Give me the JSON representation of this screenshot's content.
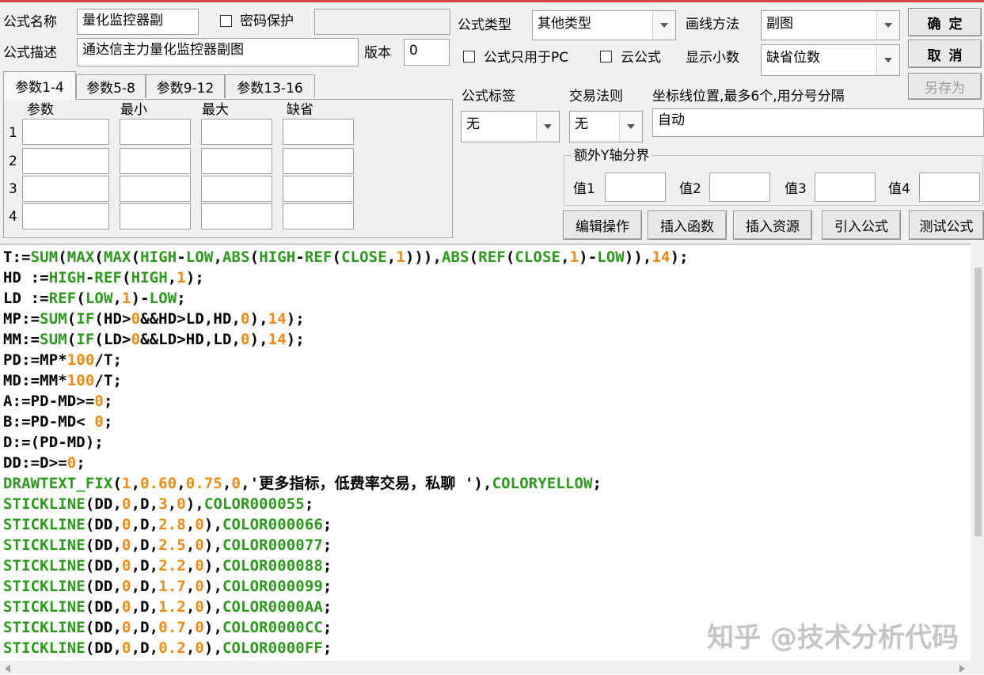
{
  "form": {
    "name_label": "公式名称",
    "name_value": "量化监控器副",
    "password_label": "密码保护",
    "password_value": "",
    "desc_label": "公式描述",
    "desc_value": "通达信主力量化监控器副图",
    "version_label": "版本",
    "version_value": "0",
    "type_label": "公式类型",
    "type_value": "其他类型",
    "draw_label": "画线方法",
    "draw_value": "副图",
    "pc_only_label": "公式只用于PC",
    "cloud_label": "云公式",
    "decimals_label": "显示小数",
    "decimals_value": "缺省位数",
    "tag_label": "公式标签",
    "tag_value": "无",
    "rule_label": "交易法则",
    "rule_value": "无",
    "axis_label": "坐标线位置,最多6个,用分号分隔",
    "axis_value": "自动",
    "extra_y_label": "额外Y轴分界",
    "y_values": [
      "值1",
      "值2",
      "值3",
      "值4"
    ]
  },
  "buttons": {
    "ok": "确定",
    "cancel": "取消",
    "save_as": "另存为",
    "edit_ops": "编辑操作",
    "insert_func": "插入函数",
    "insert_res": "插入资源",
    "import_formula": "引入公式",
    "test_formula": "测试公式"
  },
  "tabs": [
    "参数1-4",
    "参数5-8",
    "参数9-12",
    "参数13-16"
  ],
  "params": {
    "headers": [
      "参数",
      "最小",
      "最大",
      "缺省"
    ],
    "rows": [
      "1",
      "2",
      "3",
      "4"
    ]
  },
  "colors": {
    "keyword": "#2a9a1a",
    "number": "#f08a10",
    "text": "#000000"
  },
  "code_lines": [
    [
      [
        "T:=",
        0
      ],
      [
        "SUM",
        1
      ],
      [
        "(",
        0
      ],
      [
        "MAX",
        1
      ],
      [
        "(",
        0
      ],
      [
        "MAX",
        1
      ],
      [
        "(",
        0
      ],
      [
        "HIGH",
        1
      ],
      [
        "-",
        0
      ],
      [
        "LOW",
        1
      ],
      [
        ",",
        0
      ],
      [
        "ABS",
        1
      ],
      [
        "(",
        0
      ],
      [
        "HIGH",
        1
      ],
      [
        "-",
        0
      ],
      [
        "REF",
        1
      ],
      [
        "(",
        0
      ],
      [
        "CLOSE",
        1
      ],
      [
        ",",
        0
      ],
      [
        "1",
        2
      ],
      [
        "))),",
        0
      ],
      [
        "ABS",
        1
      ],
      [
        "(",
        0
      ],
      [
        "REF",
        1
      ],
      [
        "(",
        0
      ],
      [
        "CLOSE",
        1
      ],
      [
        ",",
        0
      ],
      [
        "1",
        2
      ],
      [
        ")-",
        0
      ],
      [
        "LOW",
        1
      ],
      [
        ")),",
        0
      ],
      [
        "14",
        2
      ],
      [
        ");",
        0
      ]
    ],
    [
      [
        "HD :=",
        0
      ],
      [
        "HIGH",
        1
      ],
      [
        "-",
        0
      ],
      [
        "REF",
        1
      ],
      [
        "(",
        0
      ],
      [
        "HIGH",
        1
      ],
      [
        ",",
        0
      ],
      [
        "1",
        2
      ],
      [
        ");",
        0
      ]
    ],
    [
      [
        "LD :=",
        0
      ],
      [
        "REF",
        1
      ],
      [
        "(",
        0
      ],
      [
        "LOW",
        1
      ],
      [
        ",",
        0
      ],
      [
        "1",
        2
      ],
      [
        ")-",
        0
      ],
      [
        "LOW",
        1
      ],
      [
        ";",
        0
      ]
    ],
    [
      [
        "MP:=",
        0
      ],
      [
        "SUM",
        1
      ],
      [
        "(",
        0
      ],
      [
        "IF",
        1
      ],
      [
        "(HD>",
        0
      ],
      [
        "0",
        2
      ],
      [
        "&&HD>LD,HD,",
        0
      ],
      [
        "0",
        2
      ],
      [
        "),",
        0
      ],
      [
        "14",
        2
      ],
      [
        ");",
        0
      ]
    ],
    [
      [
        "MM:=",
        0
      ],
      [
        "SUM",
        1
      ],
      [
        "(",
        0
      ],
      [
        "IF",
        1
      ],
      [
        "(LD>",
        0
      ],
      [
        "0",
        2
      ],
      [
        "&&LD>HD,LD,",
        0
      ],
      [
        "0",
        2
      ],
      [
        "),",
        0
      ],
      [
        "14",
        2
      ],
      [
        ");",
        0
      ]
    ],
    [
      [
        "PD:=MP*",
        0
      ],
      [
        "100",
        2
      ],
      [
        "/T;",
        0
      ]
    ],
    [
      [
        "MD:=MM*",
        0
      ],
      [
        "100",
        2
      ],
      [
        "/T;",
        0
      ]
    ],
    [
      [
        "A:=PD-MD>=",
        0
      ],
      [
        "0",
        2
      ],
      [
        ";",
        0
      ]
    ],
    [
      [
        "B:=PD-MD< ",
        0
      ],
      [
        "0",
        2
      ],
      [
        ";",
        0
      ]
    ],
    [
      [
        "D:=(PD-MD);",
        0
      ]
    ],
    [
      [
        "DD:=D>=",
        0
      ],
      [
        "0",
        2
      ],
      [
        ";",
        0
      ]
    ],
    [
      [
        "DRAWTEXT_FIX",
        1
      ],
      [
        "(",
        0
      ],
      [
        "1",
        2
      ],
      [
        ",",
        0
      ],
      [
        "0.60",
        2
      ],
      [
        ",",
        0
      ],
      [
        "0.75",
        2
      ],
      [
        ",",
        0
      ],
      [
        "0",
        2
      ],
      [
        ",'更多指标，低费率交易，私聊 '),",
        0
      ],
      [
        "COLORYELLOW",
        1
      ],
      [
        ";",
        0
      ]
    ],
    [
      [
        "STICKLINE",
        1
      ],
      [
        "(DD,",
        0
      ],
      [
        "0",
        2
      ],
      [
        ",D,",
        0
      ],
      [
        "3",
        2
      ],
      [
        ",",
        0
      ],
      [
        "0",
        2
      ],
      [
        "),",
        0
      ],
      [
        "COLOR000055",
        1
      ],
      [
        ";",
        0
      ]
    ],
    [
      [
        "STICKLINE",
        1
      ],
      [
        "(DD,",
        0
      ],
      [
        "0",
        2
      ],
      [
        ",D,",
        0
      ],
      [
        "2.8",
        2
      ],
      [
        ",",
        0
      ],
      [
        "0",
        2
      ],
      [
        "),",
        0
      ],
      [
        "COLOR000066",
        1
      ],
      [
        ";",
        0
      ]
    ],
    [
      [
        "STICKLINE",
        1
      ],
      [
        "(DD,",
        0
      ],
      [
        "0",
        2
      ],
      [
        ",D,",
        0
      ],
      [
        "2.5",
        2
      ],
      [
        ",",
        0
      ],
      [
        "0",
        2
      ],
      [
        "),",
        0
      ],
      [
        "COLOR000077",
        1
      ],
      [
        ";",
        0
      ]
    ],
    [
      [
        "STICKLINE",
        1
      ],
      [
        "(DD,",
        0
      ],
      [
        "0",
        2
      ],
      [
        ",D,",
        0
      ],
      [
        "2.2",
        2
      ],
      [
        ",",
        0
      ],
      [
        "0",
        2
      ],
      [
        "),",
        0
      ],
      [
        "COLOR000088",
        1
      ],
      [
        ";",
        0
      ]
    ],
    [
      [
        "STICKLINE",
        1
      ],
      [
        "(DD,",
        0
      ],
      [
        "0",
        2
      ],
      [
        ",D,",
        0
      ],
      [
        "1.7",
        2
      ],
      [
        ",",
        0
      ],
      [
        "0",
        2
      ],
      [
        "),",
        0
      ],
      [
        "COLOR000099",
        1
      ],
      [
        ";",
        0
      ]
    ],
    [
      [
        "STICKLINE",
        1
      ],
      [
        "(DD,",
        0
      ],
      [
        "0",
        2
      ],
      [
        ",D,",
        0
      ],
      [
        "1.2",
        2
      ],
      [
        ",",
        0
      ],
      [
        "0",
        2
      ],
      [
        "),",
        0
      ],
      [
        "COLOR0000AA",
        1
      ],
      [
        ";",
        0
      ]
    ],
    [
      [
        "STICKLINE",
        1
      ],
      [
        "(DD,",
        0
      ],
      [
        "0",
        2
      ],
      [
        ",D,",
        0
      ],
      [
        "0.7",
        2
      ],
      [
        ",",
        0
      ],
      [
        "0",
        2
      ],
      [
        "),",
        0
      ],
      [
        "COLOR0000CC",
        1
      ],
      [
        ";",
        0
      ]
    ],
    [
      [
        "STICKLINE",
        1
      ],
      [
        "(DD,",
        0
      ],
      [
        "0",
        2
      ],
      [
        ",D,",
        0
      ],
      [
        "0.2",
        2
      ],
      [
        ",",
        0
      ],
      [
        "0",
        2
      ],
      [
        "),",
        0
      ],
      [
        "COLOR0000FF",
        1
      ],
      [
        ";",
        0
      ]
    ]
  ],
  "watermark": "知乎 @技术分析代码"
}
